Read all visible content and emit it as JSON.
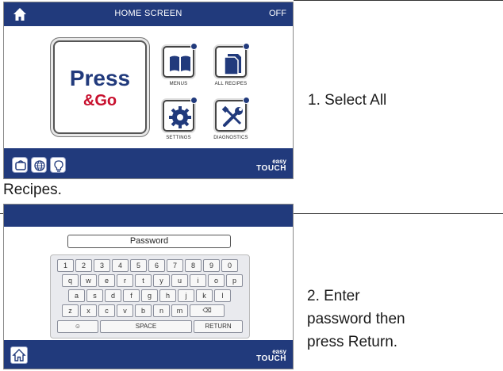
{
  "screen1": {
    "title": "HOME SCREEN",
    "status": "OFF",
    "press_go": {
      "line1": "Press",
      "line2": "&Go"
    },
    "tiles": [
      {
        "label": "MENUS",
        "icon": "book-icon"
      },
      {
        "label": "ALL RECIPES",
        "icon": "document-icon"
      },
      {
        "label": "SETTINGS",
        "icon": "gear-icon"
      },
      {
        "label": "DIAGNOSTICS",
        "icon": "tools-icon"
      }
    ],
    "bottom_icons": [
      "cart-icon",
      "globe-icon",
      "lightbulb-icon"
    ],
    "logo": {
      "line1": "easy",
      "line2": "TOUCH"
    }
  },
  "caption1": {
    "line1": "1.  Select All",
    "line2": "Recipes."
  },
  "screen2": {
    "password_placeholder": "Password",
    "rows": [
      [
        "1",
        "2",
        "3",
        "4",
        "5",
        "6",
        "7",
        "8",
        "9",
        "0"
      ],
      [
        "q",
        "w",
        "e",
        "r",
        "t",
        "y",
        "u",
        "i",
        "o",
        "p"
      ],
      [
        "a",
        "s",
        "d",
        "f",
        "g",
        "h",
        "j",
        "k",
        "l"
      ],
      [
        "z",
        "x",
        "c",
        "v",
        "b",
        "n",
        "m"
      ]
    ],
    "backspace": "⌫",
    "symbol_key": "☺",
    "space_label": "SPACE",
    "return_label": "RETURN",
    "logo": {
      "line1": "easy",
      "line2": "TOUCH"
    }
  },
  "caption2": {
    "line1": "2. Enter",
    "line2": "password then",
    "line3": "press Return."
  },
  "colors": {
    "bar": "#213a7c",
    "accent_red": "#c8102e"
  }
}
